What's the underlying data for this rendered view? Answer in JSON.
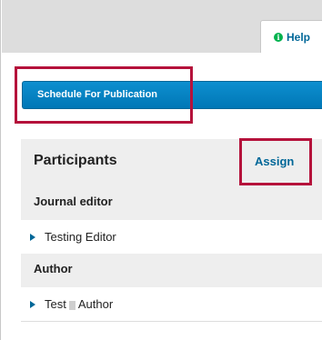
{
  "help_tab": {
    "label": "Help",
    "icon": "info-icon"
  },
  "schedule_button": {
    "label": "Schedule For Publication"
  },
  "participants": {
    "title": "Participants",
    "assign_label": "Assign",
    "groups": [
      {
        "label": "Journal editor",
        "members": [
          "Testing Editor"
        ]
      },
      {
        "label": "Author",
        "members": [
          "Test",
          "Author"
        ]
      }
    ]
  },
  "colors": {
    "accent": "#006798",
    "button": "#0077b6",
    "highlight": "#b5123b",
    "help_icon": "#00b24e"
  }
}
